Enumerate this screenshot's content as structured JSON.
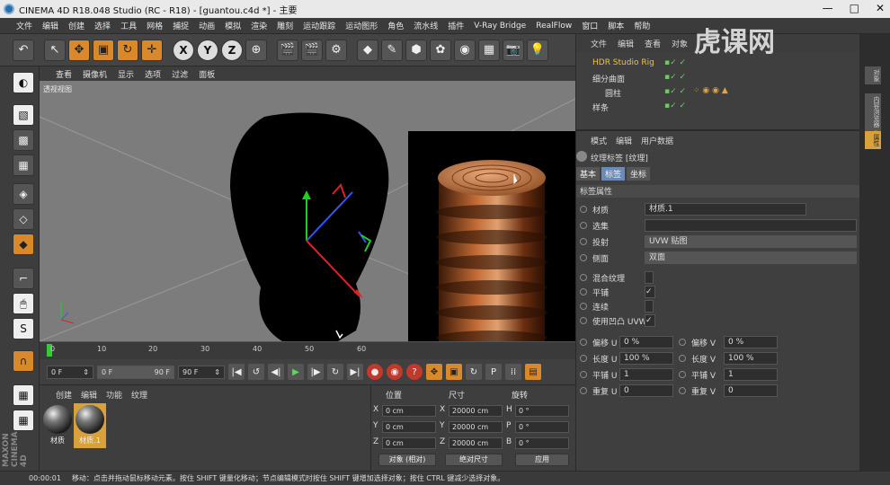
{
  "title": {
    "text": "CINEMA 4D R18.048 Studio (RC - R18) - [guantou.c4d *] - 主要",
    "minimize": "—",
    "maximize": "□",
    "close": "✕"
  },
  "menu": [
    "文件",
    "编辑",
    "创建",
    "选择",
    "工具",
    "网格",
    "捕捉",
    "动画",
    "模拟",
    "渲染",
    "雕刻",
    "运动跟踪",
    "运动图形",
    "角色",
    "流水线",
    "插件",
    "V-Ray Bridge",
    "RealFlow",
    "窗口",
    "脚本",
    "帮助"
  ],
  "toolbar_axes": [
    "X",
    "Y",
    "Z"
  ],
  "viewport": {
    "menu": [
      "查看",
      "摄像机",
      "显示",
      "选项",
      "过滤",
      "面板"
    ],
    "label": "透视视图"
  },
  "timeline": {
    "ticks": [
      "0",
      "10",
      "20",
      "30",
      "40",
      "50",
      "60"
    ]
  },
  "playback": {
    "start": "0 F",
    "current": "0 F",
    "end_inner": "90 F",
    "end": "90 F"
  },
  "materials": {
    "menu": [
      "创建",
      "编辑",
      "功能",
      "纹理"
    ],
    "items": [
      {
        "name": "材质"
      },
      {
        "name": "材质.1"
      }
    ]
  },
  "coords": {
    "headers": [
      "位置",
      "尺寸",
      "旋转"
    ],
    "rows": [
      {
        "axis": "X",
        "pos": "0 cm",
        "size_axis": "X",
        "size": "20000 cm",
        "rot_axis": "H",
        "rot": "0 °"
      },
      {
        "axis": "Y",
        "pos": "0 cm",
        "size_axis": "Y",
        "size": "20000 cm",
        "rot_axis": "P",
        "rot": "0 °"
      },
      {
        "axis": "Z",
        "pos": "0 cm",
        "size_axis": "Z",
        "size": "20000 cm",
        "rot_axis": "B",
        "rot": "0 °"
      }
    ],
    "mode_object": "对象 (相对)",
    "mode_size": "绝对尺寸",
    "apply": "应用"
  },
  "objects": {
    "menu": [
      "文件",
      "编辑",
      "查看",
      "对象"
    ],
    "rows": [
      {
        "name": "HDR Studio Rig"
      },
      {
        "name": "细分曲面"
      },
      {
        "name": "圆柱"
      },
      {
        "name": "样条"
      }
    ]
  },
  "attributes": {
    "menu": [
      "模式",
      "编辑",
      "用户数据"
    ],
    "header": "纹理标签 [纹理]",
    "tabs": [
      "基本",
      "标签",
      "坐标"
    ],
    "section": "标签属性",
    "rows": [
      {
        "label": "材质",
        "value": "材质.1"
      },
      {
        "label": "选集",
        "value": ""
      },
      {
        "label": "投射",
        "value": "UVW 贴图"
      },
      {
        "label": "侧面",
        "value": "双面"
      },
      {
        "label": "混合纹理",
        "value": ""
      },
      {
        "label": "平铺",
        "value": "✓"
      },
      {
        "label": "连续",
        "value": ""
      },
      {
        "label": "使用凹凸 UVW",
        "value": "✓"
      }
    ],
    "pairs": [
      {
        "l1": "偏移 U",
        "v1": "0 %",
        "l2": "偏移 V",
        "v2": "0 %"
      },
      {
        "l1": "长度 U",
        "v1": "100 %",
        "l2": "长度 V",
        "v2": "100 %"
      },
      {
        "l1": "平铺 U",
        "v1": "1",
        "l2": "平铺 V",
        "v2": "1"
      },
      {
        "l1": "重复 U",
        "v1": "0",
        "l2": "重复 V",
        "v2": "0"
      }
    ]
  },
  "right_tabs": [
    "对象",
    "内容浏览器",
    "构造",
    "属性"
  ],
  "status": {
    "time": "00:00:01",
    "text": "移动：点击并拖动鼠标移动元素。按住 SHIFT 键量化移动；节点编辑模式时按住 SHIFT 键增加选择对象；按住 CTRL 键减少选择对象。"
  },
  "watermark": "虎课网",
  "maxon": "MAXON CINEMA 4D"
}
